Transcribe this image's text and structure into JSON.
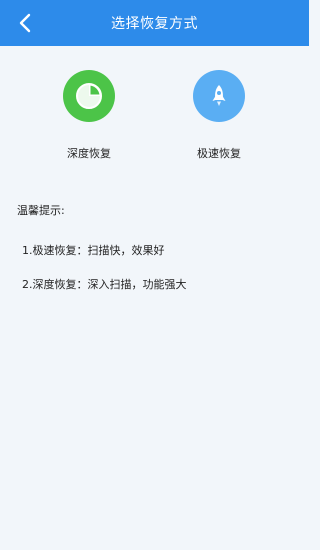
{
  "header": {
    "title": "选择恢复方式",
    "back_icon": "chevron-left-icon"
  },
  "options": [
    {
      "label": "深度恢复",
      "icon": "pie-chart-icon",
      "color": "#4cc448"
    },
    {
      "label": "极速恢复",
      "icon": "rocket-icon",
      "color": "#5aaef3"
    }
  ],
  "tips": {
    "title": "温馨提示:",
    "items": [
      "1.极速恢复：扫描快，效果好",
      "2.深度恢复：深入扫描，功能强大"
    ]
  },
  "colors": {
    "header_bg": "#2d8bea",
    "page_bg": "#f2f6fa"
  }
}
